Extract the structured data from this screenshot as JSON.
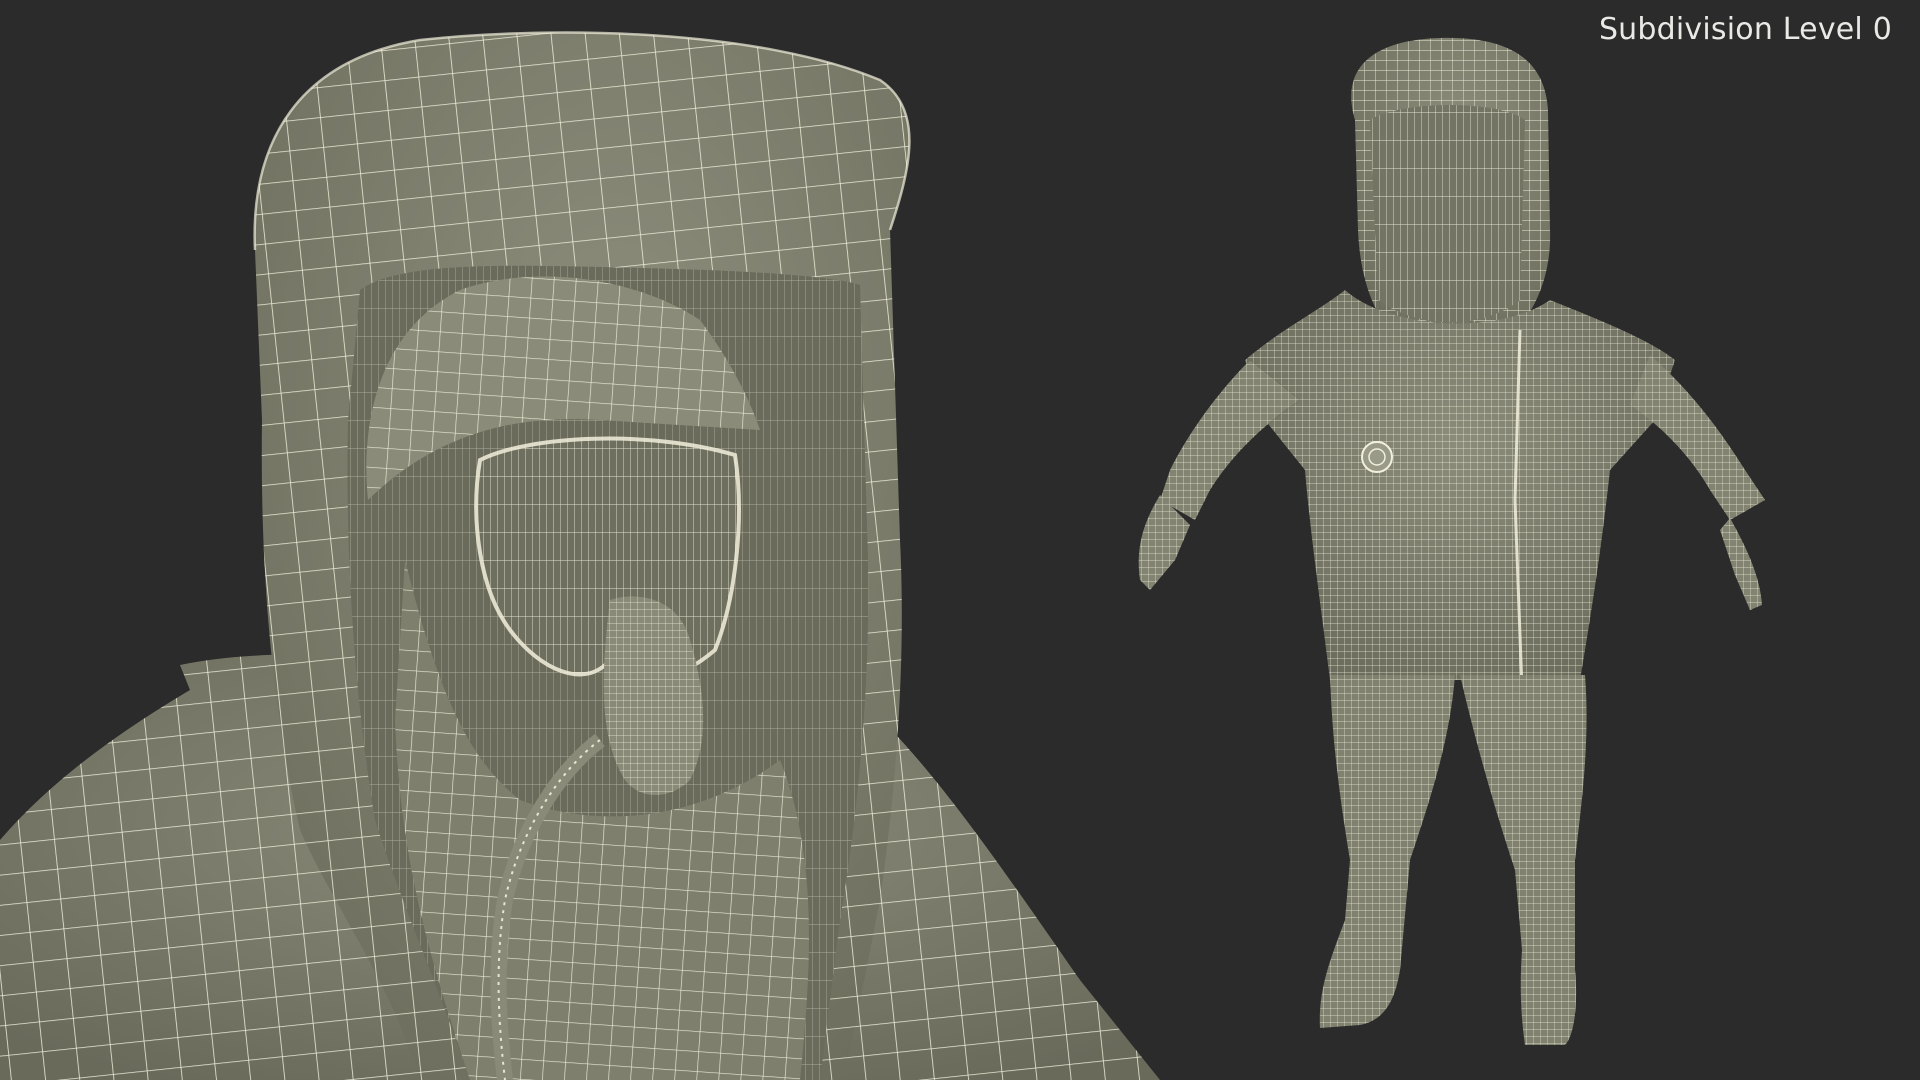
{
  "overlay": {
    "label": "Subdivision Level 0"
  },
  "scene": {
    "subject": "hazmat-suit-wireframe",
    "views": [
      "closeup-head",
      "full-body"
    ]
  },
  "colors": {
    "background": "#2b2b2b",
    "surface": "#82826f",
    "surface_shadow": "#6e6e5e",
    "surface_light": "#97978a",
    "wire": "#f2f0dc",
    "label": "#e9e9e6"
  }
}
